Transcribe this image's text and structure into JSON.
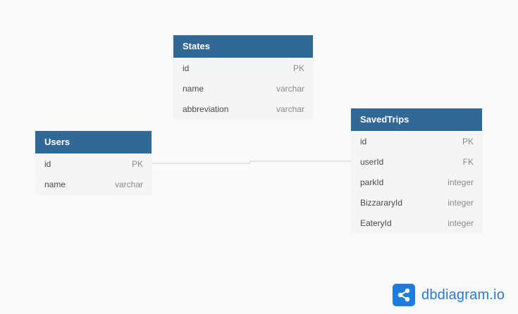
{
  "tables": {
    "states": {
      "name": "States",
      "columns": [
        {
          "name": "id",
          "type": "PK"
        },
        {
          "name": "name",
          "type": "varchar"
        },
        {
          "name": "abbreviation",
          "type": "varchar"
        }
      ]
    },
    "users": {
      "name": "Users",
      "columns": [
        {
          "name": "id",
          "type": "PK"
        },
        {
          "name": "name",
          "type": "varchar"
        }
      ]
    },
    "savedtrips": {
      "name": "SavedTrips",
      "columns": [
        {
          "name": "id",
          "type": "PK"
        },
        {
          "name": "userId",
          "type": "FK"
        },
        {
          "name": "parkId",
          "type": "integer"
        },
        {
          "name": "BizzararyId",
          "type": "integer"
        },
        {
          "name": "EateryId",
          "type": "integer"
        }
      ]
    }
  },
  "relationships": [
    {
      "from": "users.id",
      "to": "savedtrips.userId"
    }
  ],
  "brand": {
    "name": "dbdiagram.io",
    "icon": "share-nodes-icon",
    "color": "#1e7be0"
  },
  "colors": {
    "header": "#316896",
    "background": "#fafafb",
    "row": "#f5f5f6"
  }
}
